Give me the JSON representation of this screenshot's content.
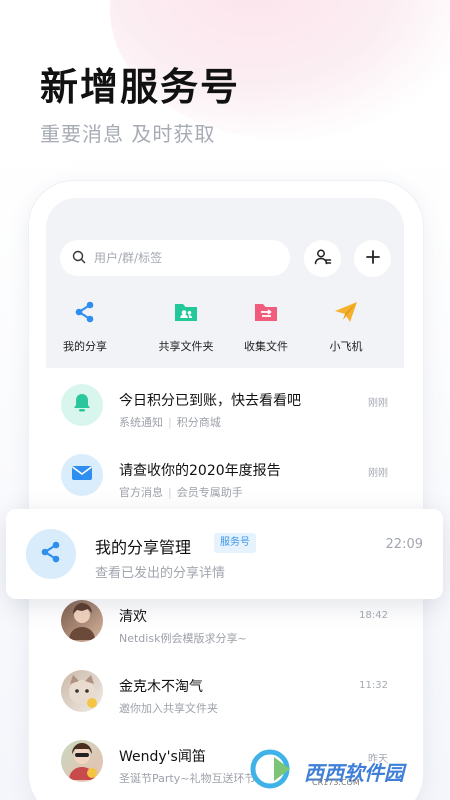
{
  "hero": {
    "title": "新增服务号",
    "subtitle": "重要消息 及时获取"
  },
  "search": {
    "placeholder": "用户/群/标签"
  },
  "actions": {
    "add_contact": "add-contact-icon",
    "add": "plus-icon"
  },
  "quick_actions": [
    {
      "label": "我的分享",
      "icon": "share-icon",
      "color": "#2e8ff0"
    },
    {
      "label": "共享文件夹",
      "icon": "shared-folder-icon",
      "color": "#22c79a"
    },
    {
      "label": "收集文件",
      "icon": "collect-folder-icon",
      "color": "#f15c7d"
    },
    {
      "label": "小飞机",
      "icon": "paper-plane-icon",
      "color": "#f6b12c"
    }
  ],
  "messages": [
    {
      "title": "今日积分已到账，快去看看吧",
      "sub_a": "系统通知",
      "sub_b": "积分商城",
      "time": "刚刚",
      "avatar_icon": "bell-icon"
    },
    {
      "title": "请查收你的2020年度报告",
      "sub_a": "官方消息",
      "sub_b": "会员专属助手",
      "time": "刚刚",
      "avatar_icon": "mail-icon"
    },
    {
      "title": "清欢",
      "sub": "Netdisk例会模版求分享~",
      "time": "18:42",
      "avatar_icon": "user-avatar"
    },
    {
      "title": "金克木不淘气",
      "sub": "邀你加入共享文件夹",
      "time": "11:32",
      "avatar_icon": "user-avatar"
    },
    {
      "title": "Wendy's闻笛",
      "sub": "圣诞节Party~礼物互送环节",
      "time": "昨天",
      "avatar_icon": "user-avatar"
    }
  ],
  "service_card": {
    "title": "我的分享管理",
    "badge": "服务号",
    "subtitle": "查看已发出的分享详情",
    "time": "22:09"
  },
  "watermark": {
    "text": "西西软件园",
    "url": "CR173.COM"
  },
  "colors": {
    "accent": "#2e8ff0",
    "badge_bg": "#e6f3fd",
    "muted": "#a5a9b2"
  }
}
